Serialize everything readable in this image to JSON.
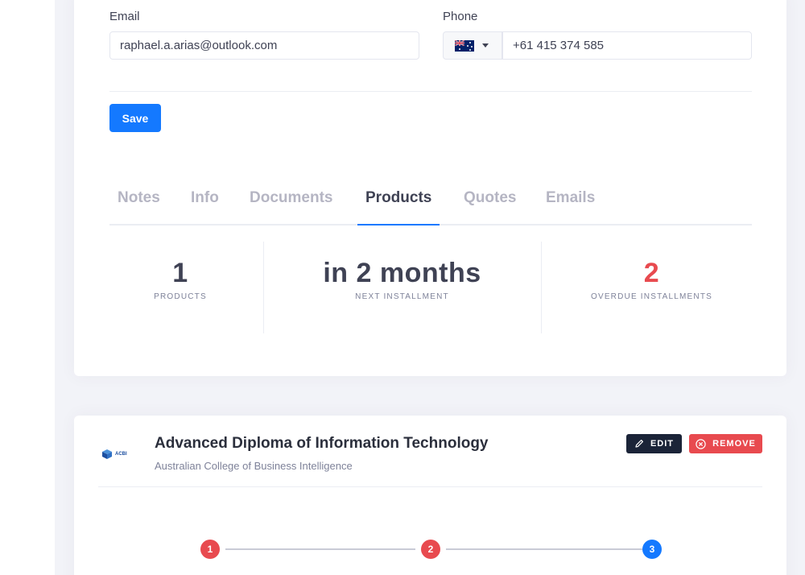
{
  "contact": {
    "email_label": "Email",
    "email_value": "raphael.a.arias@outlook.com",
    "phone_label": "Phone",
    "phone_country": "Australia",
    "phone_value": "+61 415 374 585"
  },
  "actions": {
    "save_label": "Save"
  },
  "tabs": [
    {
      "label": "Notes",
      "active": false
    },
    {
      "label": "Info",
      "active": false
    },
    {
      "label": "Documents",
      "active": false
    },
    {
      "label": "Products",
      "active": true
    },
    {
      "label": "Quotes",
      "active": false
    },
    {
      "label": "Emails",
      "active": false
    }
  ],
  "stats": [
    {
      "value": "1",
      "caption": "PRODUCTS"
    },
    {
      "value": "in 2 months",
      "caption": "NEXT INSTALLMENT"
    },
    {
      "value": "2",
      "caption": "OVERDUE INSTALLMENTS"
    }
  ],
  "product": {
    "logo_text": "ACBI",
    "title": "Advanced Diploma of Information Technology",
    "institution": "Australian College of Business Intelligence",
    "edit_label": "EDIT",
    "remove_label": "REMOVE",
    "steps": [
      {
        "number": "1",
        "status": "overdue"
      },
      {
        "number": "2",
        "status": "overdue"
      },
      {
        "number": "3",
        "status": "current"
      }
    ]
  },
  "colors": {
    "primary": "#1479ff",
    "danger": "#e84a4f",
    "dark": "#1b2438",
    "muted": "#b5b5c3",
    "background": "#f2f3f8"
  },
  "icons": [
    "australia-flag-icon",
    "chevron-down-icon",
    "pencil-icon",
    "close-circle-icon"
  ]
}
